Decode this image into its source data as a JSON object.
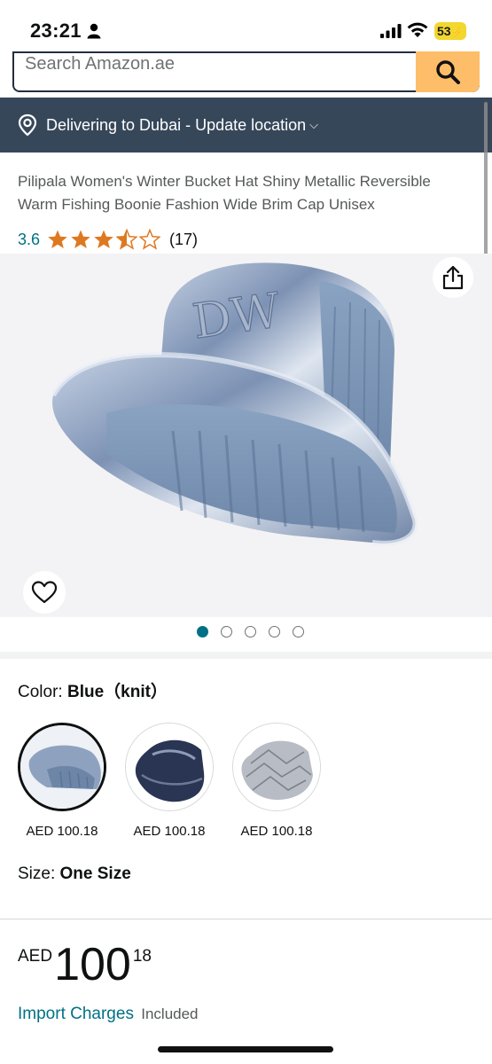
{
  "status_bar": {
    "time": "23:21",
    "battery": "53"
  },
  "search": {
    "placeholder": "Search Amazon.ae"
  },
  "delivery": {
    "text": "Delivering to Dubai - Update location"
  },
  "product": {
    "title": "Pilipala Women's Winter Bucket Hat Shiny Metallic Reversible Warm Fishing Boonie Fashion Wide Brim Cap Unisex",
    "rating_value": "3.6",
    "rating_stars": 3.5,
    "rating_count": "(17)"
  },
  "gallery": {
    "image_count": 5,
    "active_index": 0
  },
  "color": {
    "label": "Color: ",
    "value": "Blue（knit）",
    "options": [
      {
        "name": "Blue (knit)",
        "price": "AED 100.18",
        "selected": true
      },
      {
        "name": "Navy",
        "price": "AED 100.18",
        "selected": false
      },
      {
        "name": "Silver",
        "price": "AED 100.18",
        "selected": false
      }
    ]
  },
  "size": {
    "label": "Size: ",
    "value": "One Size"
  },
  "price": {
    "currency": "AED",
    "whole": "100",
    "fraction": "18"
  },
  "import": {
    "link": "Import Charges",
    "note": "Included"
  },
  "colors": {
    "accent": "#007185",
    "search_button": "#febd69",
    "delivery_bar": "#37475a",
    "star": "#de7921"
  }
}
